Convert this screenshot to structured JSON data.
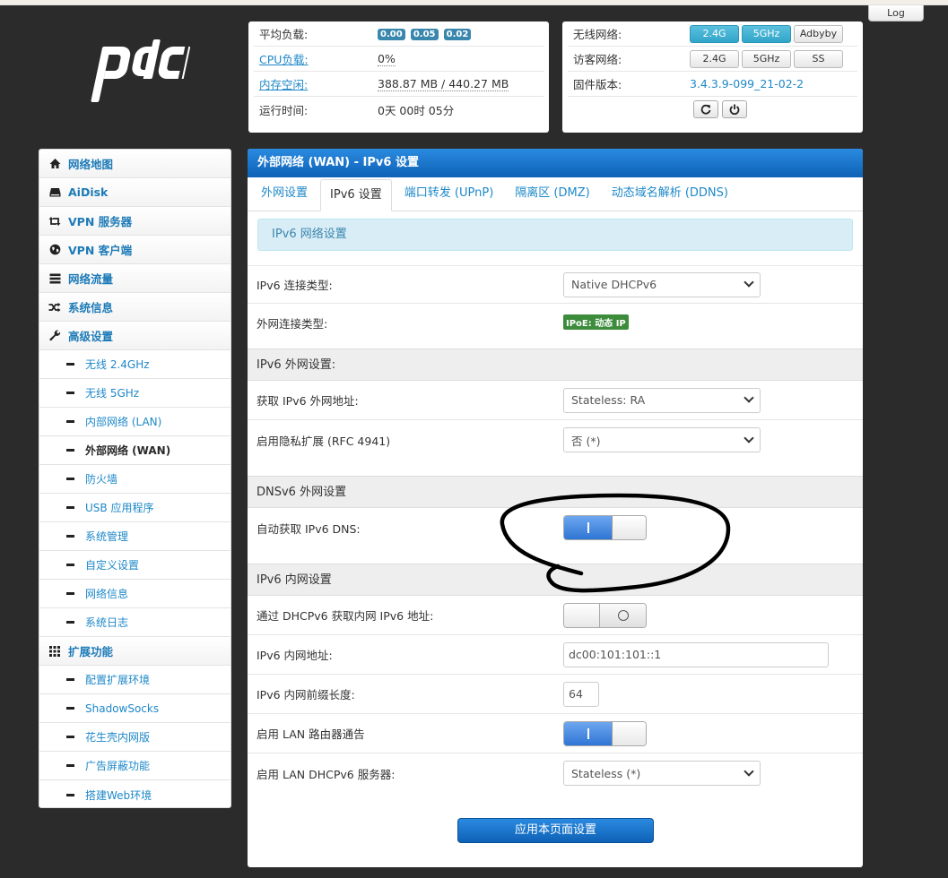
{
  "header": {
    "log_button": "Log",
    "logo_text": "pdcn"
  },
  "status_left": {
    "load_label": "平均负载:",
    "load_values": [
      "0.00",
      "0.05",
      "0.02"
    ],
    "cpu_label": "CPU负载:",
    "cpu_value": "0%",
    "mem_label": "内存空闲:",
    "mem_value": "388.87 MB / 440.27 MB",
    "uptime_label": "运行时间:",
    "uptime_value": "0天 00时 05分"
  },
  "status_right": {
    "wireless_label": "无线网络:",
    "wireless_buttons": [
      "2.4G",
      "5GHz",
      "Adbyby"
    ],
    "guest_label": "访客网络:",
    "guest_buttons": [
      "2.4G",
      "5GHz",
      "SS"
    ],
    "firmware_label": "固件版本:",
    "firmware_value": "3.4.3.9-099_21-02-2"
  },
  "sidebar": {
    "items": [
      {
        "label": "网络地图",
        "icon": "home-icon"
      },
      {
        "label": "AiDisk",
        "icon": "hdd-icon"
      },
      {
        "label": "VPN 服务器",
        "icon": "retweet-icon"
      },
      {
        "label": "VPN 客户端",
        "icon": "globe-icon"
      },
      {
        "label": "网络流量",
        "icon": "list-icon"
      },
      {
        "label": "系统信息",
        "icon": "random-icon"
      },
      {
        "label": "高级设置",
        "icon": "wrench-icon"
      }
    ],
    "advanced_sub": [
      "无线 2.4GHz",
      "无线 5GHz",
      "内部网络 (LAN)",
      "外部网络 (WAN)",
      "防火墙",
      "USB 应用程序",
      "系统管理",
      "自定义设置",
      "网络信息",
      "系统日志"
    ],
    "ext_label": "扩展功能",
    "ext_icon": "grid-icon",
    "ext_sub": [
      "配置扩展环境",
      "ShadowSocks",
      "花生壳内网版",
      "广告屏蔽功能",
      "搭建Web环境"
    ]
  },
  "main": {
    "title": "外部网络 (WAN) - IPv6 设置",
    "tabs": [
      "外网设置",
      "IPv6 设置",
      "端口转发 (UPnP)",
      "隔离区 (DMZ)",
      "动态域名解析 (DDNS)"
    ],
    "info": "IPv6 网络设置",
    "conn_type_label": "IPv6 连接类型:",
    "conn_type_value": "Native DHCPv6",
    "wan_type_label": "外网连接类型:",
    "wan_type_badge": "IPoE: 动态 IP",
    "sec_wan": "IPv6 外网设置:",
    "get_addr_label": "获取 IPv6 外网地址:",
    "get_addr_value": "Stateless: RA",
    "privacy_label": "启用隐私扩展 (RFC 4941)",
    "privacy_value": "否 (*)",
    "sec_dns": "DNSv6 外网设置",
    "auto_dns_label": "自动获取 IPv6 DNS:",
    "sec_lan": "IPv6 内网设置",
    "dhcp_lan_label": "通过 DHCPv6 获取内网 IPv6 地址:",
    "lan_addr_label": "IPv6 内网地址:",
    "lan_addr_value": "dc00:101:101::1",
    "prefix_label": "IPv6 内网前缀长度:",
    "prefix_value": "64",
    "router_adv_label": "启用 LAN 路由器通告",
    "dhcp_server_label": "启用 LAN DHCPv6 服务器:",
    "dhcp_server_value": "Stateless (*)",
    "apply_button": "应用本页面设置"
  },
  "colors": {
    "accent_blue": "#0e62b6",
    "link_blue": "#1e88c8",
    "badge_green": "#3c8c3c",
    "toggle_on": "#2f75d4"
  }
}
